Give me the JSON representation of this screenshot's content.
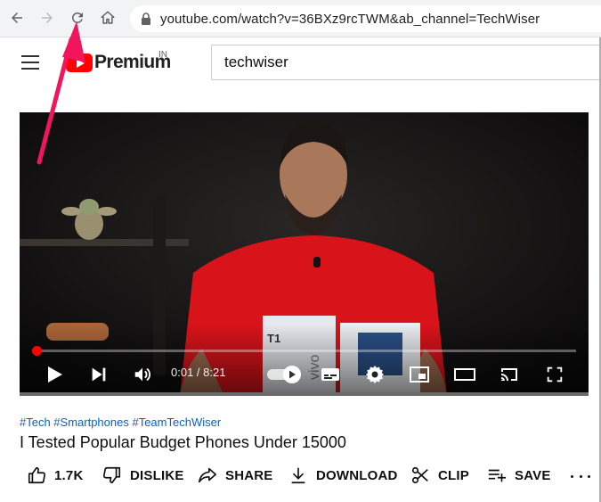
{
  "browser": {
    "url": "youtube.com/watch?v=36BXz9rcTWM&ab_channel=TechWiser",
    "icons": [
      "back-arrow-icon",
      "forward-arrow-icon",
      "reload-icon",
      "home-icon",
      "lock-icon"
    ]
  },
  "header": {
    "logo_text": "Premium",
    "country_code": "IN",
    "search_value": "techwiser"
  },
  "player": {
    "time_display": "0:01 / 8:21",
    "progress_fraction": 0.005,
    "autoplay": "on",
    "icons": [
      "play-icon",
      "next-icon",
      "volume-icon",
      "autoplay-toggle",
      "subtitles-icon",
      "settings-icon",
      "miniplayer-icon",
      "theater-icon",
      "cast-icon",
      "fullscreen-icon"
    ]
  },
  "video": {
    "hashtags": "#Tech #Smartphones #TeamTechWiser",
    "title": "I Tested Popular Budget Phones Under 15000",
    "box_label_t1": "T1",
    "box_label_vivo": "vivo"
  },
  "actions": {
    "like": "1.7K",
    "dislike": "DISLIKE",
    "share": "SHARE",
    "download": "DOWNLOAD",
    "clip": "CLIP",
    "save": "SAVE"
  },
  "colors": {
    "annotation_arrow": "#f0155c",
    "brand_red": "#ff0000",
    "link_blue": "#065fd4"
  }
}
